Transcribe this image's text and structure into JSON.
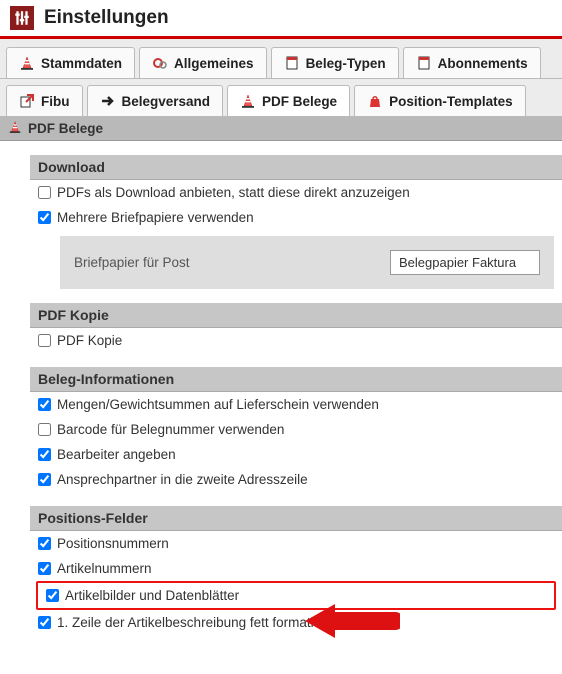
{
  "header": {
    "title": "Einstellungen"
  },
  "tabs_row1": [
    {
      "label": "Stammdaten",
      "icon": "cone"
    },
    {
      "label": "Allgemeines",
      "icon": "gears"
    },
    {
      "label": "Beleg-Typen",
      "icon": "doc"
    },
    {
      "label": "Abonnements",
      "icon": "doc"
    }
  ],
  "tabs_row2": [
    {
      "label": "Fibu",
      "icon": "export"
    },
    {
      "label": "Belegversand",
      "icon": "arrow"
    },
    {
      "label": "PDF Belege",
      "icon": "cone",
      "active": true
    },
    {
      "label": "Position-Templates",
      "icon": "bag"
    }
  ],
  "sub_bar": {
    "label": "PDF Belege"
  },
  "sections": {
    "download": {
      "title": "Download",
      "opt1": {
        "label": "PDFs als Download anbieten, statt diese direkt anzuzeigen",
        "checked": false
      },
      "opt2": {
        "label": "Mehrere Briefpapiere verwenden",
        "checked": true
      },
      "sub": {
        "label": "Briefpapier für Post",
        "value": "Belegpapier Faktura"
      }
    },
    "kopie": {
      "title": "PDF Kopie",
      "opt1": {
        "label": "PDF Kopie",
        "checked": false
      }
    },
    "info": {
      "title": "Beleg-Informationen",
      "opt1": {
        "label": "Mengen/Gewichtsummen auf Lieferschein verwenden",
        "checked": true
      },
      "opt2": {
        "label": "Barcode für Belegnummer verwenden",
        "checked": false
      },
      "opt3": {
        "label": "Bearbeiter angeben",
        "checked": true
      },
      "opt4": {
        "label": "Ansprechpartner in die zweite Adresszeile",
        "checked": true
      }
    },
    "pos": {
      "title": "Positions-Felder",
      "opt1": {
        "label": "Positionsnummern",
        "checked": true
      },
      "opt2": {
        "label": "Artikelnummern",
        "checked": true
      },
      "opt3": {
        "label": "Artikelbilder und Datenblätter",
        "checked": true
      },
      "opt4": {
        "label": "1. Zeile der Artikelbeschreibung fett formatieren",
        "checked": true
      }
    }
  }
}
